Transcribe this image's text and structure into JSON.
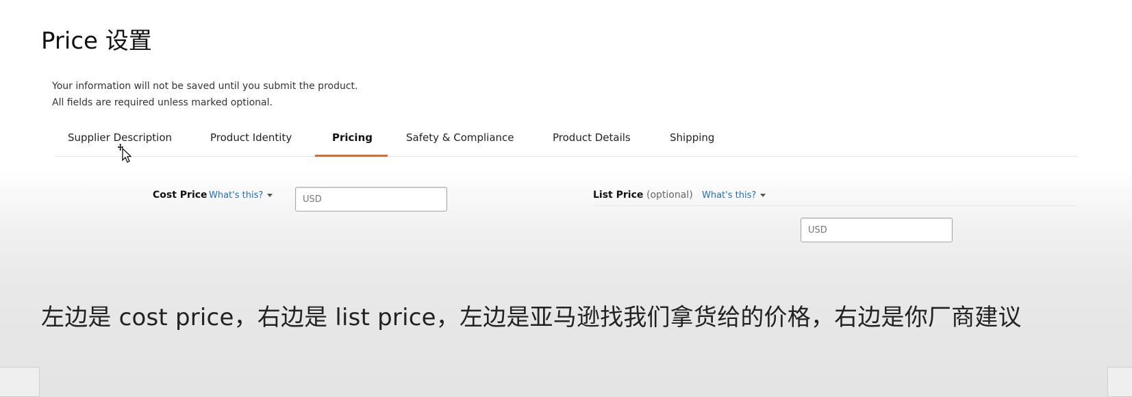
{
  "page": {
    "title": "Price 设置",
    "subtitle": "左边是 cost price，右边是 list price，左边是亚马逊找我们拿货给的价格，右边是你厂商建议"
  },
  "notice": {
    "line1": "Your information will not be saved until you submit the product.",
    "line2": "All fields are required unless marked optional."
  },
  "tabs": [
    {
      "label": "Supplier Description",
      "active": false
    },
    {
      "label": "Product Identity",
      "active": false
    },
    {
      "label": "Pricing",
      "active": true
    },
    {
      "label": "Safety & Compliance",
      "active": false
    },
    {
      "label": "Product Details",
      "active": false
    },
    {
      "label": "Shipping",
      "active": false
    }
  ],
  "cost_price": {
    "label": "Cost Price",
    "help_link": "What's this?",
    "input_placeholder": "USD",
    "input_value": ""
  },
  "list_price": {
    "label": "List Price",
    "optional_text": "(optional)",
    "help_link": "What's this?",
    "input_placeholder": "USD",
    "input_value": ""
  },
  "icons": {
    "cursor": "move-cursor-icon",
    "dropdown": "caret-down-icon"
  },
  "colors": {
    "active_tab_underline": "#d86a2b",
    "link": "#1e6fb6"
  }
}
